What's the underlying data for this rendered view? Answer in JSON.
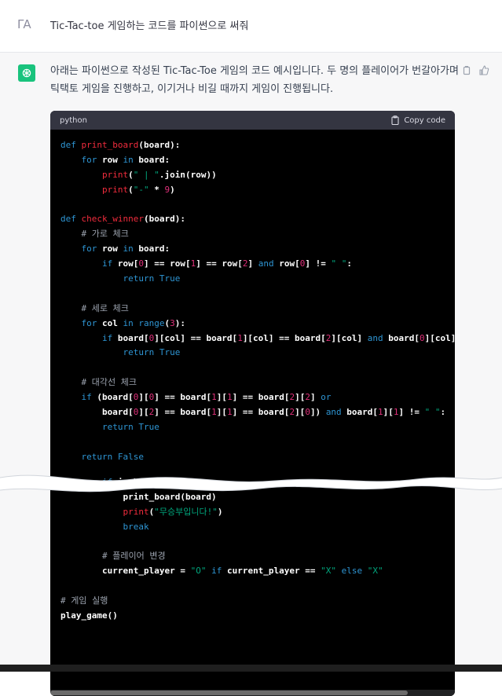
{
  "user": {
    "avatar_text": "ΓA",
    "prompt": "Tic-Tac-toe 게임하는 코드를 파이썬으로 써줘"
  },
  "assistant": {
    "intro": "아래는 파이썬으로 작성된 Tic-Tac-Toe 게임의 코드 예시입니다. 두 명의 플레이어가 번갈아가며 틱택토 게임을 진행하고, 이기거나 비길 때까지 게임이 진행됩니다.",
    "actions": [
      "copy-icon",
      "thumbs-up-icon"
    ]
  },
  "code_block": {
    "language": "python",
    "copy_label": "Copy code",
    "lines_top": [
      "def print_board(board):",
      "    for row in board:",
      "        print(\" | \".join(row))",
      "        print(\"-\" * 9)",
      "",
      "def check_winner(board):",
      "    # 가로 체크",
      "    for row in board:",
      "        if row[0] == row[1] == row[2] and row[0] != \" \":",
      "            return True",
      "",
      "    # 세로 체크",
      "    for col in range(3):",
      "        if board[0][col] == board[1][col] == board[2][col] and board[0][col]",
      "            return True",
      "",
      "    # 대각선 체크",
      "    if (board[0][0] == board[1][1] == board[2][2] or",
      "        board[0][2] == board[1][1] == board[2][0]) and board[1][1] != \" \":",
      "        return True",
      "",
      "    return False"
    ],
    "lines_bottom": [
      "        if is_board_",
      "            print_board(board)",
      "            print(\"무승부입니다!\")",
      "            break",
      "",
      "        # 플레이어 변경",
      "        current_player = \"O\" if current_player == \"X\" else \"X\"",
      "",
      "# 게임 실행",
      "play_game()"
    ]
  },
  "colors": {
    "keyword": "#2e95d3",
    "function": "#f22c3d",
    "string": "#00a67d",
    "number": "#df3079",
    "comment": "#9ca3af"
  }
}
